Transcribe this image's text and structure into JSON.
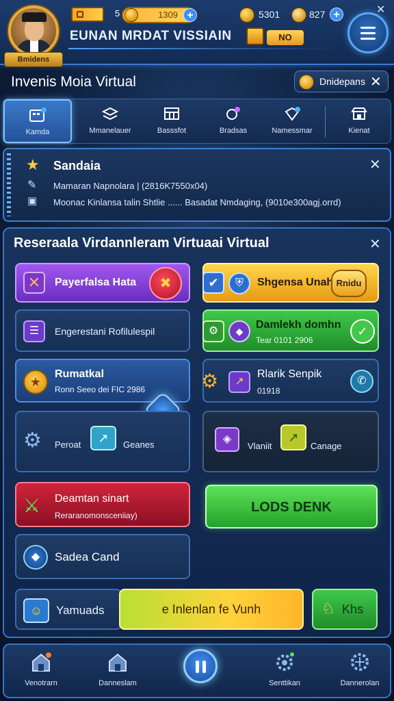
{
  "header": {
    "avatar_name": "Bmidens",
    "level": "5",
    "xp_value": "1309",
    "coins": "5301",
    "gems": "827",
    "title": "EUNAN MRDAT VISSIAIN",
    "chest_label": "NO"
  },
  "subheader": {
    "page_title": "Invenis Moia Virtual",
    "chip_label": "Dnidepans"
  },
  "tabs": [
    {
      "label": "Kamda",
      "icon": "inventory-icon"
    },
    {
      "label": "Mmanelauer",
      "icon": "crafting-icon"
    },
    {
      "label": "Basssfot",
      "icon": "chest-icon"
    },
    {
      "label": "Bradsas",
      "icon": "skills-icon"
    },
    {
      "label": "Namessmar",
      "icon": "gems-icon"
    },
    {
      "label": "Kienat",
      "icon": "shop-icon"
    }
  ],
  "notice": {
    "title": "Sandaia",
    "line1": "Mamaran Napnolara | (2816K7550x04)",
    "line2": "Moonac Kinlansa talin Shtlie ...... Basadat Nmdaging, (9010e300agj.orrd)"
  },
  "panel": {
    "title": "Reseraala Virdannleram Virtuaai Virtual",
    "cards": {
      "purple": {
        "title": "Payerfalsa Hata"
      },
      "yellow": {
        "title": "Shgensa Unah",
        "badge": "Rnidu"
      },
      "blue1": {
        "title": "Engerestani Rofilulespil"
      },
      "green1": {
        "title": "Damlekh domhn",
        "sub": "Tear 0101 2906"
      },
      "blue2": {
        "title": "Rumatkal",
        "sub": "Ronn Seeo dei FIC 2986"
      },
      "dark1": {
        "title": "Rlarik Senpik",
        "sub": "01918"
      },
      "box1": {
        "left_label": "Peroat",
        "right_label": "Geanes"
      },
      "box2": {
        "left_label": "Vlaniit",
        "right_label": "Canage"
      },
      "red": {
        "title": "Deamtan sinart",
        "sub": "Reraranomonsceniiay)"
      },
      "green_button": {
        "label": "LODS DENK"
      },
      "shield": {
        "title": "Sadea Cand"
      }
    },
    "action_row": {
      "left_label": "Yamuads",
      "mid_label": "e Inlenlan fe Vunh",
      "right_label": "Khs"
    }
  },
  "bottom_nav": [
    {
      "label": "Venotrarn",
      "icon": "home-icon"
    },
    {
      "label": "Danneslam",
      "icon": "house-icon"
    },
    {
      "label": "",
      "icon": "pause-icon"
    },
    {
      "label": "Senttikan",
      "icon": "settings-icon"
    },
    {
      "label": "Dannerolan",
      "icon": "gear-icon"
    }
  ],
  "colors": {
    "accent": "#3f8ef5",
    "gold": "#e2ae3e",
    "green": "#3fc84a",
    "red": "#d0243a",
    "purple": "#a157ee"
  }
}
